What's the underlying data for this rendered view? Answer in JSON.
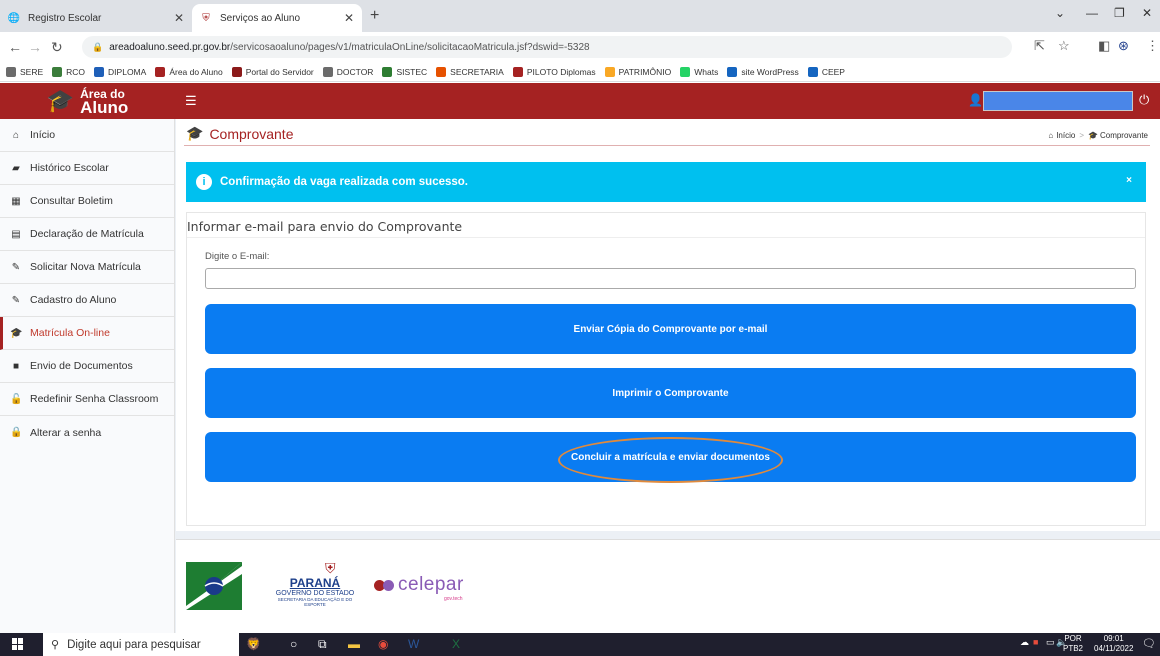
{
  "browser": {
    "tabs": [
      {
        "title": "Registro Escolar",
        "icon": "globe-icon"
      },
      {
        "title": "Serviços ao Aluno",
        "icon": "parana-crest-icon"
      }
    ],
    "url_host": "areadoaluno.seed.pr.gov.br",
    "url_path": "/servicosaoaluno/pages/v1/matriculaOnLine/solicitacaoMatricula.jsf?dswid=-5328",
    "bookmarks": [
      "SERE",
      "RCO",
      "DIPLOMA",
      "Área do Aluno",
      "Portal do Servidor",
      "DOCTOR",
      "SISTEC",
      "SECRETARIA",
      "PILOTO Diplomas",
      "PATRIMÔNIO",
      "Whats",
      "site WordPress",
      "CEEP"
    ],
    "bookmark_colors": [
      "#6b6b6b",
      "#3b7d3b",
      "#1f5fb8",
      "#a52222",
      "#8b1a1a",
      "#6b6b6b",
      "#2e7d32",
      "#e65100",
      "#a52222",
      "#f9a825",
      "#25d366",
      "#1565c0",
      "#1565c0"
    ]
  },
  "header": {
    "logo_line1": "Área do",
    "logo_line2": "Aluno",
    "brand_color": "#a52222"
  },
  "sidebar": {
    "items": [
      {
        "label": "Início",
        "icon": "home-icon"
      },
      {
        "label": "Histórico Escolar",
        "icon": "folder-open-icon"
      },
      {
        "label": "Consultar Boletim",
        "icon": "grid-icon"
      },
      {
        "label": "Declaração de Matrícula",
        "icon": "document-icon"
      },
      {
        "label": "Solicitar Nova Matrícula",
        "icon": "edit-icon"
      },
      {
        "label": "Cadastro do Aluno",
        "icon": "edit-icon"
      },
      {
        "label": "Matrícula On-line",
        "icon": "graduation-cap-icon"
      },
      {
        "label": "Envio de Documentos",
        "icon": "folder-icon"
      },
      {
        "label": "Redefinir Senha Classroom",
        "icon": "unlock-icon"
      },
      {
        "label": "Alterar a senha",
        "icon": "lock-icon"
      }
    ],
    "active_index": 6
  },
  "main": {
    "page_title": "Comprovante",
    "breadcrumb_home": "Início",
    "breadcrumb_current": "Comprovante",
    "alert_text": "Confirmação da vaga realizada com sucesso.",
    "alert_close": "×",
    "box_title": "Informar e-mail para envio do Comprovante",
    "email_label": "Digite o E-mail:",
    "email_value": "",
    "buttons": {
      "send_copy": "Enviar Cópia do Comprovante por e-mail",
      "print": "Imprimir o Comprovante",
      "finish": "Concluir a matrícula e enviar documentos"
    }
  },
  "footer": {
    "parana_name": "PARANÁ",
    "parana_gov": "GOVERNO DO ESTADO",
    "parana_secretaria": "SECRETARIA DA EDUCAÇÃO E DO ESPORTE",
    "celepar_name": "celepar",
    "celepar_tag": "gov.tech"
  },
  "taskbar": {
    "search_placeholder": "Digite aqui para pesquisar",
    "lang_1": "POR",
    "lang_2": "PTB2",
    "time": "09:01",
    "date": "04/11/2022"
  }
}
